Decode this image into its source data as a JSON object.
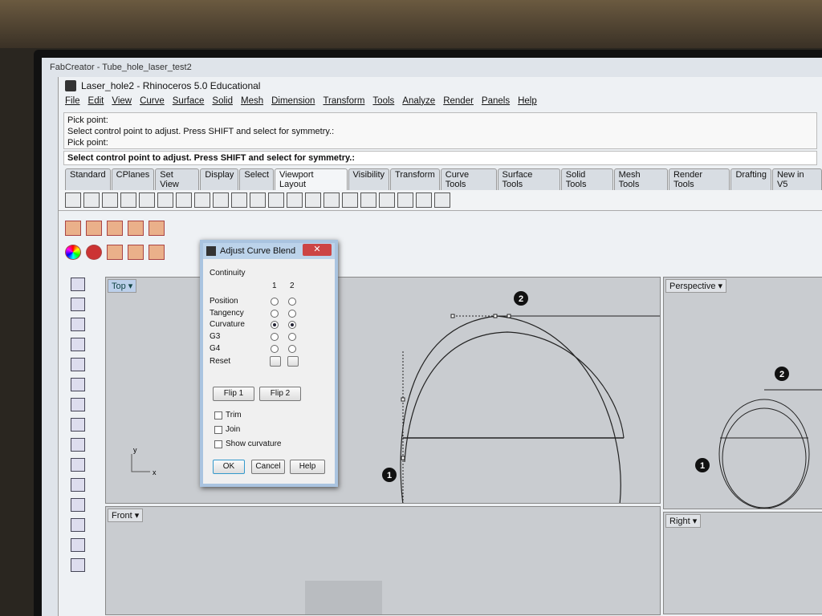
{
  "outer_window": {
    "title": "FabCreator - Tube_hole_laser_test2"
  },
  "window": {
    "title": "Laser_hole2 - Rhinoceros 5.0 Educational"
  },
  "menu": [
    "File",
    "Edit",
    "View",
    "Curve",
    "Surface",
    "Solid",
    "Mesh",
    "Dimension",
    "Transform",
    "Tools",
    "Analyze",
    "Render",
    "Panels",
    "Help"
  ],
  "command_history": [
    "Pick point:",
    "Select control point to adjust. Press SHIFT and select for symmetry.:",
    "Pick point:"
  ],
  "command_prompt": "Select control point to adjust. Press SHIFT and select for symmetry.:",
  "tabs": [
    "Standard",
    "CPlanes",
    "Set View",
    "Display",
    "Select",
    "Viewport Layout",
    "Visibility",
    "Transform",
    "Curve Tools",
    "Surface Tools",
    "Solid Tools",
    "Mesh Tools",
    "Render Tools",
    "Drafting",
    "New in V5"
  ],
  "active_tab": "Viewport Layout",
  "viewports": {
    "top": "Top",
    "perspective": "Perspective",
    "front": "Front",
    "right": "Right"
  },
  "markers": {
    "one": "1",
    "two": "2"
  },
  "axis": {
    "x": "x",
    "y": "y"
  },
  "dialog": {
    "title": "Adjust Curve Blend",
    "close": "✕",
    "group": "Continuity",
    "col1": "1",
    "col2": "2",
    "rows": [
      {
        "label": "Position",
        "c1": false,
        "c2": false
      },
      {
        "label": "Tangency",
        "c1": false,
        "c2": false
      },
      {
        "label": "Curvature",
        "c1": true,
        "c2": true
      },
      {
        "label": "G3",
        "c1": false,
        "c2": false
      },
      {
        "label": "G4",
        "c1": false,
        "c2": false
      }
    ],
    "reset": "Reset",
    "flip1": "Flip 1",
    "flip2": "Flip 2",
    "trim": "Trim",
    "join": "Join",
    "show_curvature": "Show curvature",
    "ok": "OK",
    "cancel": "Cancel",
    "help": "Help"
  }
}
